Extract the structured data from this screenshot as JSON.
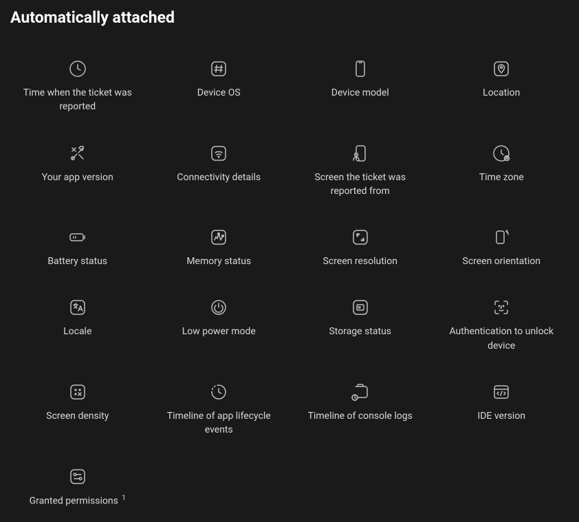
{
  "title": "Automatically attached",
  "items": [
    {
      "label": "Time when the ticket was reported",
      "icon": "clock-icon"
    },
    {
      "label": "Device OS",
      "icon": "hash-icon"
    },
    {
      "label": "Device model",
      "icon": "phone-icon"
    },
    {
      "label": "Location",
      "icon": "location-pin-icon"
    },
    {
      "label": "Your app version",
      "icon": "tools-icon"
    },
    {
      "label": "Connectivity details",
      "icon": "wifi-icon"
    },
    {
      "label": "Screen the ticket was reported from",
      "icon": "screen-user-icon"
    },
    {
      "label": "Time zone",
      "icon": "timezone-icon"
    },
    {
      "label": "Battery status",
      "icon": "battery-icon"
    },
    {
      "label": "Memory status",
      "icon": "memory-icon"
    },
    {
      "label": "Screen resolution",
      "icon": "expand-icon"
    },
    {
      "label": "Screen orientation",
      "icon": "rotate-icon"
    },
    {
      "label": "Locale",
      "icon": "translate-icon"
    },
    {
      "label": "Low power mode",
      "icon": "power-icon"
    },
    {
      "label": "Storage status",
      "icon": "storage-icon"
    },
    {
      "label": "Authentication to unlock device",
      "icon": "face-id-icon"
    },
    {
      "label": "Screen density",
      "icon": "density-icon"
    },
    {
      "label": "Timeline of app lifecycle events",
      "icon": "timeline-icon"
    },
    {
      "label": "Timeline of console logs",
      "icon": "console-log-icon"
    },
    {
      "label": "IDE version",
      "icon": "ide-icon"
    },
    {
      "label": "Granted permissions",
      "icon": "permissions-icon",
      "superscript": "1"
    }
  ]
}
